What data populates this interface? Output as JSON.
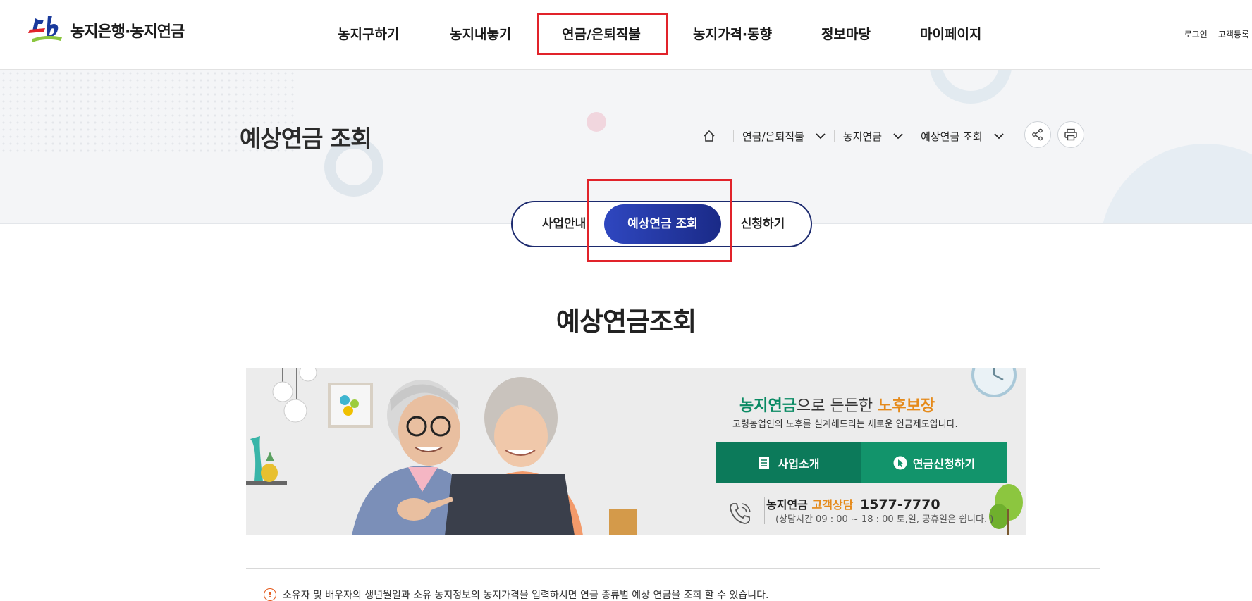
{
  "header": {
    "logo_text": "농지은행·농지연금",
    "nav": [
      "농지구하기",
      "농지내놓기",
      "연금/은퇴직불",
      "농지가격·동향",
      "정보마당",
      "마이페이지"
    ],
    "util": {
      "login": "로그인",
      "register": "고객등록"
    }
  },
  "subvisual": {
    "page_title": "예상연금 조회",
    "breadcrumb": [
      "연금/은퇴직불",
      "농지연금",
      "예상연금 조회"
    ]
  },
  "tabs": [
    "사업안내",
    "예상연금 조회",
    "신청하기"
  ],
  "main": {
    "section_title": "예상연금조회"
  },
  "banner": {
    "title_green": "농지연금",
    "title_mid": "으로 든든한 ",
    "title_orange": "노후보장",
    "subtitle": "고령농업인의 노후를 설계해드리는 새로운 연금제도입니다.",
    "btn_intro": "사업소개",
    "btn_apply": "연금신청하기",
    "contact_label": "농지연금",
    "contact_orange": "고객상담",
    "contact_number": "1577-7770",
    "hours": "(상담시간 09 : 00 ~ 18 : 00 토,일, 공휴일은 쉽니다. )"
  },
  "notice": {
    "text": "소유자 및 배우자의 생년월일과 소유 농지정보의 농지가격을 입력하시면 연금 종류별 예상 연금을 조회 할 수 있습니다."
  },
  "colors": {
    "highlight": "#e1232a",
    "tab_border": "#1c2a6e",
    "tab_active_start": "#2f47c0",
    "tab_active_end": "#1a2a87",
    "banner_green": "#0c7a5a",
    "banner_orange": "#e58a1a"
  }
}
